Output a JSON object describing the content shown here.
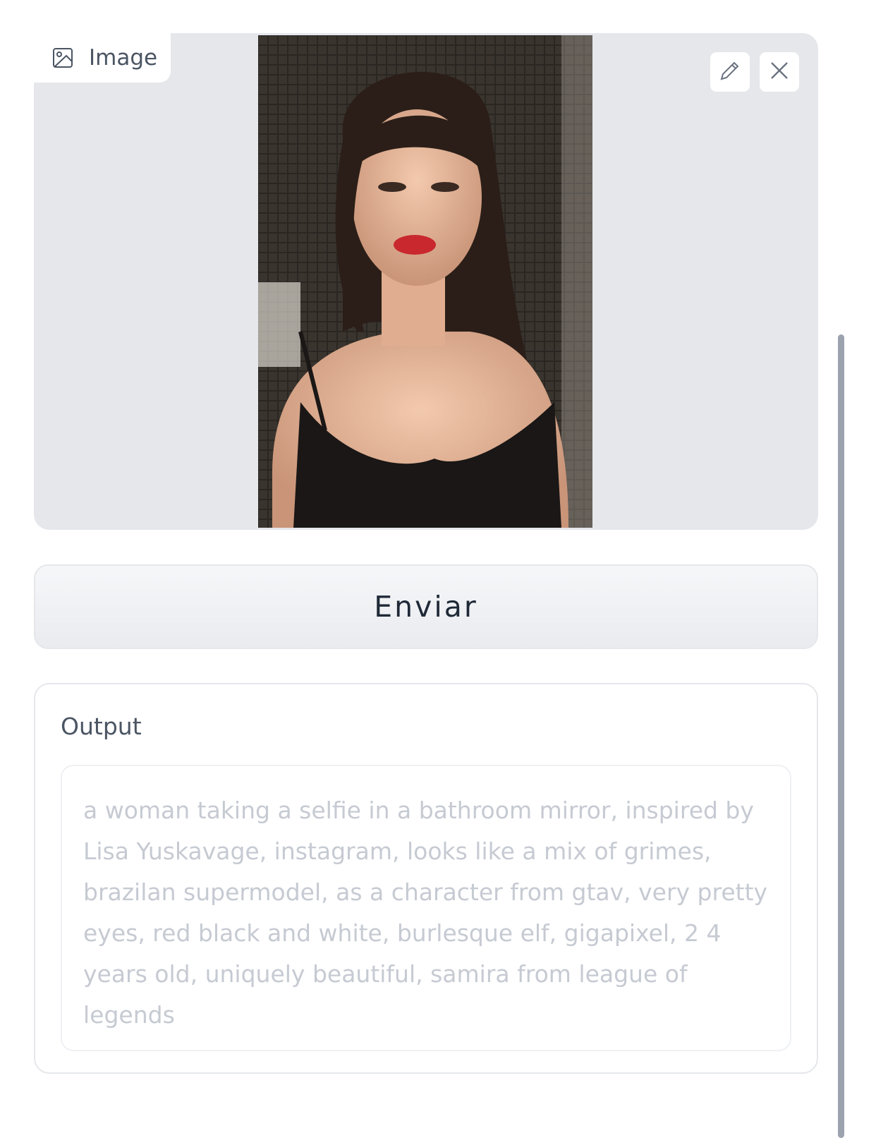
{
  "image_input": {
    "label": "Image",
    "label_icon": "image-icon",
    "edit_icon": "pencil-icon",
    "clear_icon": "close-icon"
  },
  "send_button": {
    "label": "Enviar"
  },
  "output": {
    "label": "Output",
    "text": "a woman taking a selfie in a bathroom mirror, inspired by Lisa Yuskavage, instagram, looks like a mix of grimes, brazilan supermodel, as a character from gtav, very pretty eyes, red black and white, burlesque elf, gigapixel, 2 4 years old, uniquely beautiful, samira from league of legends"
  },
  "colors": {
    "image_area_bg": "#e5e7eb",
    "button_text": "#1f2937",
    "output_text": "#c6cad2",
    "label_text": "#4b5563"
  }
}
